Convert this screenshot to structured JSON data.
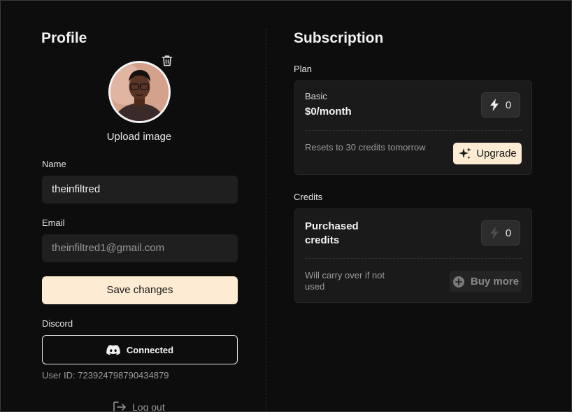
{
  "profile": {
    "title": "Profile",
    "upload_label": "Upload image",
    "name_label": "Name",
    "name_value": "theinfiltred",
    "email_label": "Email",
    "email_value": "theinfiltred1@gmail.com",
    "save_label": "Save changes",
    "discord_label": "Discord",
    "discord_status": "Connected",
    "user_id": "User ID: 723924798790434879",
    "logout_label": "Log out"
  },
  "subscription": {
    "title": "Subscription",
    "plan_label": "Plan",
    "plan_name": "Basic",
    "plan_price": "$0/month",
    "plan_credits": "0",
    "reset_text": "Resets to 30 credits tomorrow",
    "upgrade_label": "Upgrade",
    "credits_label": "Credits",
    "purchased_title": "Purchased credits",
    "purchased_credits": "0",
    "carry_text": "Will carry over if not used",
    "buy_label": "Buy more"
  },
  "colors": {
    "accent": "#fdebd3",
    "background": "#0d0d0d",
    "card": "#1a1a1a"
  },
  "icons": {
    "trash": "trash-icon",
    "discord": "discord-icon",
    "logout": "logout-icon",
    "bolt": "bolt-icon",
    "sparkle": "sparkle-icon",
    "plus": "plus-circle-icon"
  }
}
